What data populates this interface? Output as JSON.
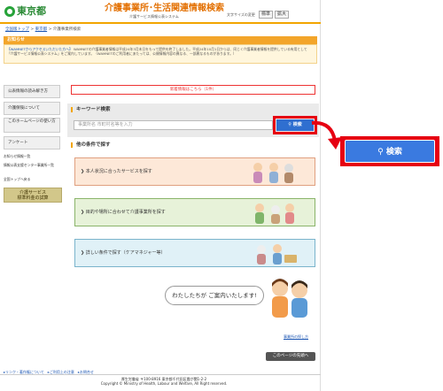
{
  "header": {
    "logo_text": "東京都",
    "site_title": "介護事業所･生活関連情報検索",
    "site_subtitle": "介護サービス情報公表システム",
    "font_size_label": "文字サイズの変更",
    "font_btn_standard": "標準",
    "font_btn_large": "拡大"
  },
  "breadcrumb": {
    "home": "全国版トップ",
    "pref": "東京都",
    "current": "介護事業所検索"
  },
  "notice": {
    "title": "お知らせ",
    "link_text": "【WAMNETからアクセスいただいた方へ】",
    "body": "WAMNETの介護事業者情報は平成24年3月末日をもって提供を終了しました。平成24年10月1日からは、同じく介護事業者情報を提供している有用として「介護サービス情報公表システム」をご案内しています。（WAMNETのご利用者にあたっては、公開情報内容の異なる、一部異なるものがあります。）"
  },
  "sidebar": {
    "items": [
      {
        "label": "公表情報の読み解き方"
      },
      {
        "label": "介護保険について"
      },
      {
        "label": "このホームページの使い方"
      },
      {
        "label": "アンケート"
      }
    ],
    "subs": [
      "お知らせ情報一覧",
      "情報公表支援センター事業所一覧",
      "全国トップへ戻る"
    ],
    "banner_line1": "介護サービス",
    "banner_line2": "標準料金の試算"
  },
  "main": {
    "new_info": "新着情報はこちら（1件）",
    "keyword_title": "キーワード検索",
    "keyword_placeholder": "事業所名 市町村名等を入力",
    "search_label": "検索",
    "cond_title": "他の条件で探す",
    "cards": [
      {
        "label": "本人状況に合ったサービスを探す",
        "bg": "#fde8d8",
        "border": "#e0a080"
      },
      {
        "label": "目的や場所に合わせて介護事業所を探す",
        "bg": "#e7f2d9",
        "border": "#8ab46a"
      },
      {
        "label": "詳しい条件で探す（ケアマネジャー等）",
        "bg": "#e0f1f7",
        "border": "#7ab4cc"
      }
    ],
    "bubble": "わたしたちが ご案内いたします!",
    "help_link": "事業所の探し方",
    "service_btn": "このページの先頭へ"
  },
  "footer": {
    "links": "▸リンク・著作権について　▸ご利用上の注意　▸お問合せ",
    "org1": "厚生労働省 〒100-8916 東京都千代田区霞が関1-2-2",
    "org2": "Copyright © Ministry of Health, Labour and Welfare, All Right reserved."
  },
  "callout": {
    "search_label": "検索"
  },
  "colors": {
    "accent": "#f2a500",
    "search_blue": "#3a7ae0",
    "highlight_red": "#e60012"
  }
}
